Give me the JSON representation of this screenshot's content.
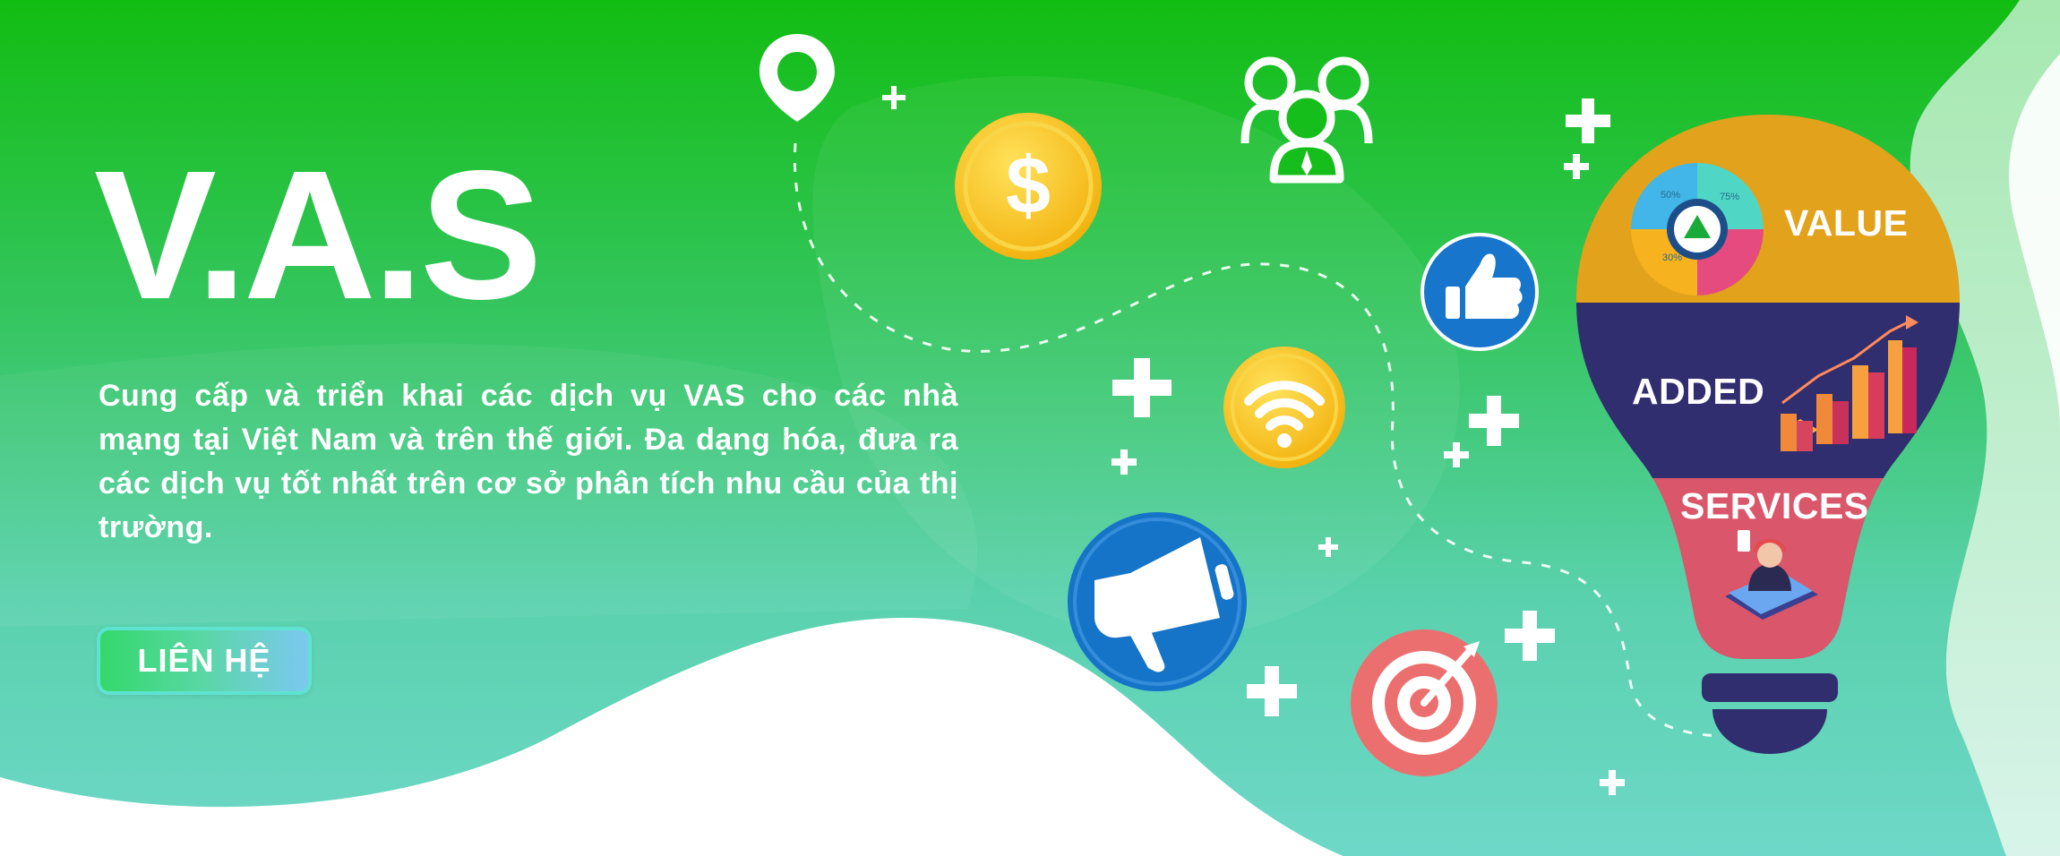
{
  "hero": {
    "title": "V.A.S",
    "description": "Cung cấp và triển khai các dịch vụ VAS cho các nhà mạng tại Việt Nam và trên thế giới. Đa dạng hóa, đưa ra các dịch vụ tốt nhất trên cơ sở phân tích nhu cầu của thị trường.",
    "cta_label": "LIÊN HỆ"
  },
  "bulb": {
    "value_label": "VALUE",
    "added_label": "ADDED",
    "services_label": "SERVICES",
    "pie_labels": [
      "50%",
      "75%",
      "30%"
    ]
  },
  "icons": [
    "location-pin-icon",
    "dollar-coin-icon",
    "team-icon",
    "thumbs-up-icon",
    "wifi-icon",
    "megaphone-icon",
    "target-icon",
    "lightbulb-icon",
    "plus-icon"
  ],
  "colors": {
    "green_top": "#14be14",
    "teal_bottom": "#6ad6c4",
    "bulb_orange": "#e2a21c",
    "bulb_navy": "#302e6e",
    "bulb_pink": "#d9566b",
    "coin_yellow": "#f7c51e",
    "icon_blue": "#1774c9",
    "target_red": "#ec6f6f"
  }
}
